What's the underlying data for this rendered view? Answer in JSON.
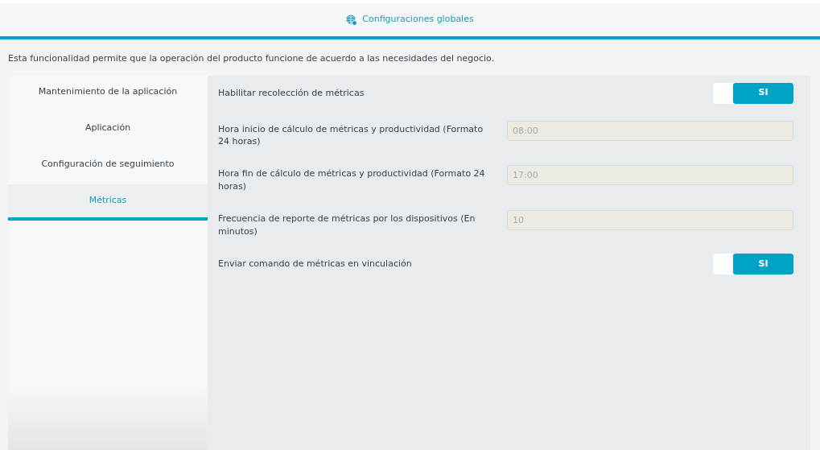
{
  "header": {
    "title": "Configuraciones globales"
  },
  "description": "Esta funcionalidad permite que la operación del producto funcione de acuerdo a las necesidades del negocio.",
  "sidebar": {
    "items": [
      {
        "label": "Mantenimiento de la aplicación",
        "selected": false
      },
      {
        "label": "Aplicación",
        "selected": false
      },
      {
        "label": "Configuración de seguimiento",
        "selected": false
      },
      {
        "label": "Métricas",
        "selected": true
      }
    ]
  },
  "settings": [
    {
      "kind": "toggle",
      "label": "Habilitar recolección de métricas",
      "on": true,
      "value": "SI"
    },
    {
      "kind": "input",
      "label": "Hora inicio de cálculo de métricas y productividad (Formato 24 horas)",
      "value": "08:00",
      "disabled": true
    },
    {
      "kind": "input",
      "label": "Hora fin de cálculo de métricas y productividad (Formato 24 horas)",
      "value": "17:00",
      "disabled": true
    },
    {
      "kind": "input",
      "label": "Frecuencia de reporte de métricas por los dispositivos (En minutos)",
      "value": "10",
      "disabled": true
    },
    {
      "kind": "toggle",
      "label": "Enviar comando de métricas en vinculación",
      "on": true,
      "value": "SI"
    }
  ]
}
